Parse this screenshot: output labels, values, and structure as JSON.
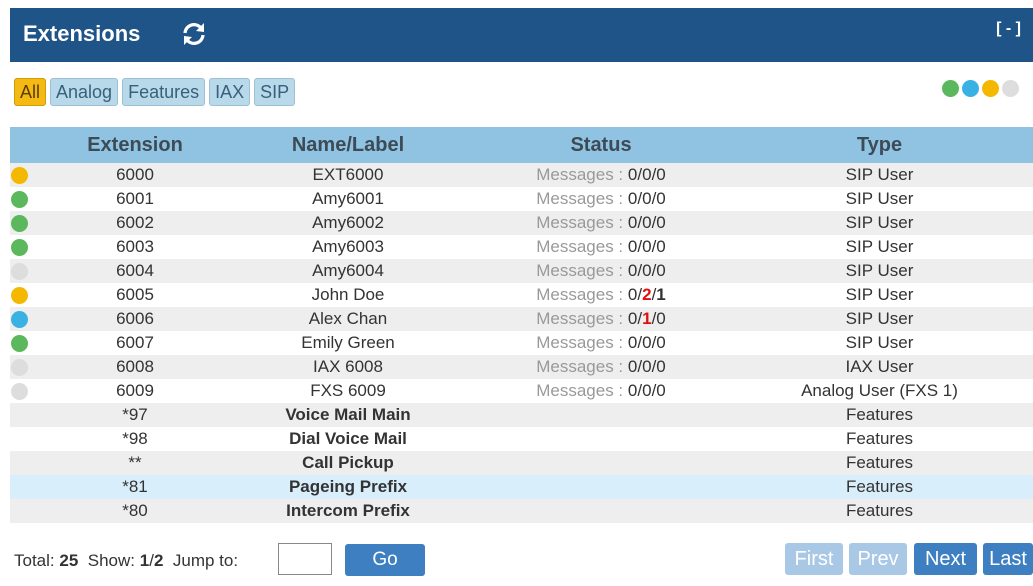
{
  "header": {
    "title": "Extensions",
    "collapse_label": "[ - ]"
  },
  "filters": [
    {
      "label": "All",
      "active": true
    },
    {
      "label": "Analog",
      "active": false
    },
    {
      "label": "Features",
      "active": false
    },
    {
      "label": "IAX",
      "active": false
    },
    {
      "label": "SIP",
      "active": false
    }
  ],
  "legend_colors": [
    "#5cb85c",
    "#3ab1e3",
    "#f5b800",
    "#dddddd"
  ],
  "status_colors": {
    "green": "#5cb85c",
    "blue": "#3ab1e3",
    "yellow": "#f5b800",
    "gray": "#dddddd"
  },
  "table": {
    "columns": [
      "Extension",
      "Name/Label",
      "Status",
      "Type"
    ],
    "rows": [
      {
        "status": "yellow",
        "extension": "6000",
        "name": "EXT6000",
        "messages_label": "Messages : ",
        "messages": [
          "0",
          "0",
          "0"
        ],
        "type": "SIP User"
      },
      {
        "status": "green",
        "extension": "6001",
        "name": "Amy6001",
        "messages_label": "Messages : ",
        "messages": [
          "0",
          "0",
          "0"
        ],
        "type": "SIP User"
      },
      {
        "status": "green",
        "extension": "6002",
        "name": "Amy6002",
        "messages_label": "Messages : ",
        "messages": [
          "0",
          "0",
          "0"
        ],
        "type": "SIP User"
      },
      {
        "status": "green",
        "extension": "6003",
        "name": "Amy6003",
        "messages_label": "Messages : ",
        "messages": [
          "0",
          "0",
          "0"
        ],
        "type": "SIP User"
      },
      {
        "status": "gray",
        "extension": "6004",
        "name": "Amy6004",
        "messages_label": "Messages : ",
        "messages": [
          "0",
          "0",
          "0"
        ],
        "type": "SIP User"
      },
      {
        "status": "yellow",
        "extension": "6005",
        "name": "John Doe",
        "messages_label": "Messages : ",
        "messages": [
          "0",
          "2",
          "1"
        ],
        "type": "SIP User"
      },
      {
        "status": "blue",
        "extension": "6006",
        "name": "Alex Chan",
        "messages_label": "Messages : ",
        "messages": [
          "0",
          "1",
          "0"
        ],
        "type": "SIP User"
      },
      {
        "status": "green",
        "extension": "6007",
        "name": "Emily Green",
        "messages_label": "Messages : ",
        "messages": [
          "0",
          "0",
          "0"
        ],
        "type": "SIP User"
      },
      {
        "status": "gray",
        "extension": "6008",
        "name": "IAX 6008",
        "messages_label": "Messages : ",
        "messages": [
          "0",
          "0",
          "0"
        ],
        "type": "IAX User"
      },
      {
        "status": "gray",
        "extension": "6009",
        "name": "FXS 6009",
        "messages_label": "Messages : ",
        "messages": [
          "0",
          "0",
          "0"
        ],
        "type": "Analog User (FXS 1)"
      },
      {
        "status": null,
        "extension": "*97",
        "name": "Voice Mail Main",
        "feature": true,
        "type": "Features"
      },
      {
        "status": null,
        "extension": "*98",
        "name": "Dial Voice Mail",
        "feature": true,
        "type": "Features"
      },
      {
        "status": null,
        "extension": "**",
        "name": "Call Pickup",
        "feature": true,
        "type": "Features"
      },
      {
        "status": null,
        "extension": "*81",
        "name": "Pageing Prefix",
        "feature": true,
        "type": "Features",
        "highlighted": true
      },
      {
        "status": null,
        "extension": "*80",
        "name": "Intercom Prefix",
        "feature": true,
        "type": "Features"
      }
    ]
  },
  "footer": {
    "total_label": "Total:",
    "total": "25",
    "show_label": "Show:",
    "show_page": "1",
    "show_sep": "/",
    "show_total": "2",
    "jump_label": "Jump to:",
    "jump_value": "",
    "go_label": "Go",
    "first_label": "First",
    "prev_label": "Prev",
    "next_label": "Next",
    "last_label": "Last"
  }
}
